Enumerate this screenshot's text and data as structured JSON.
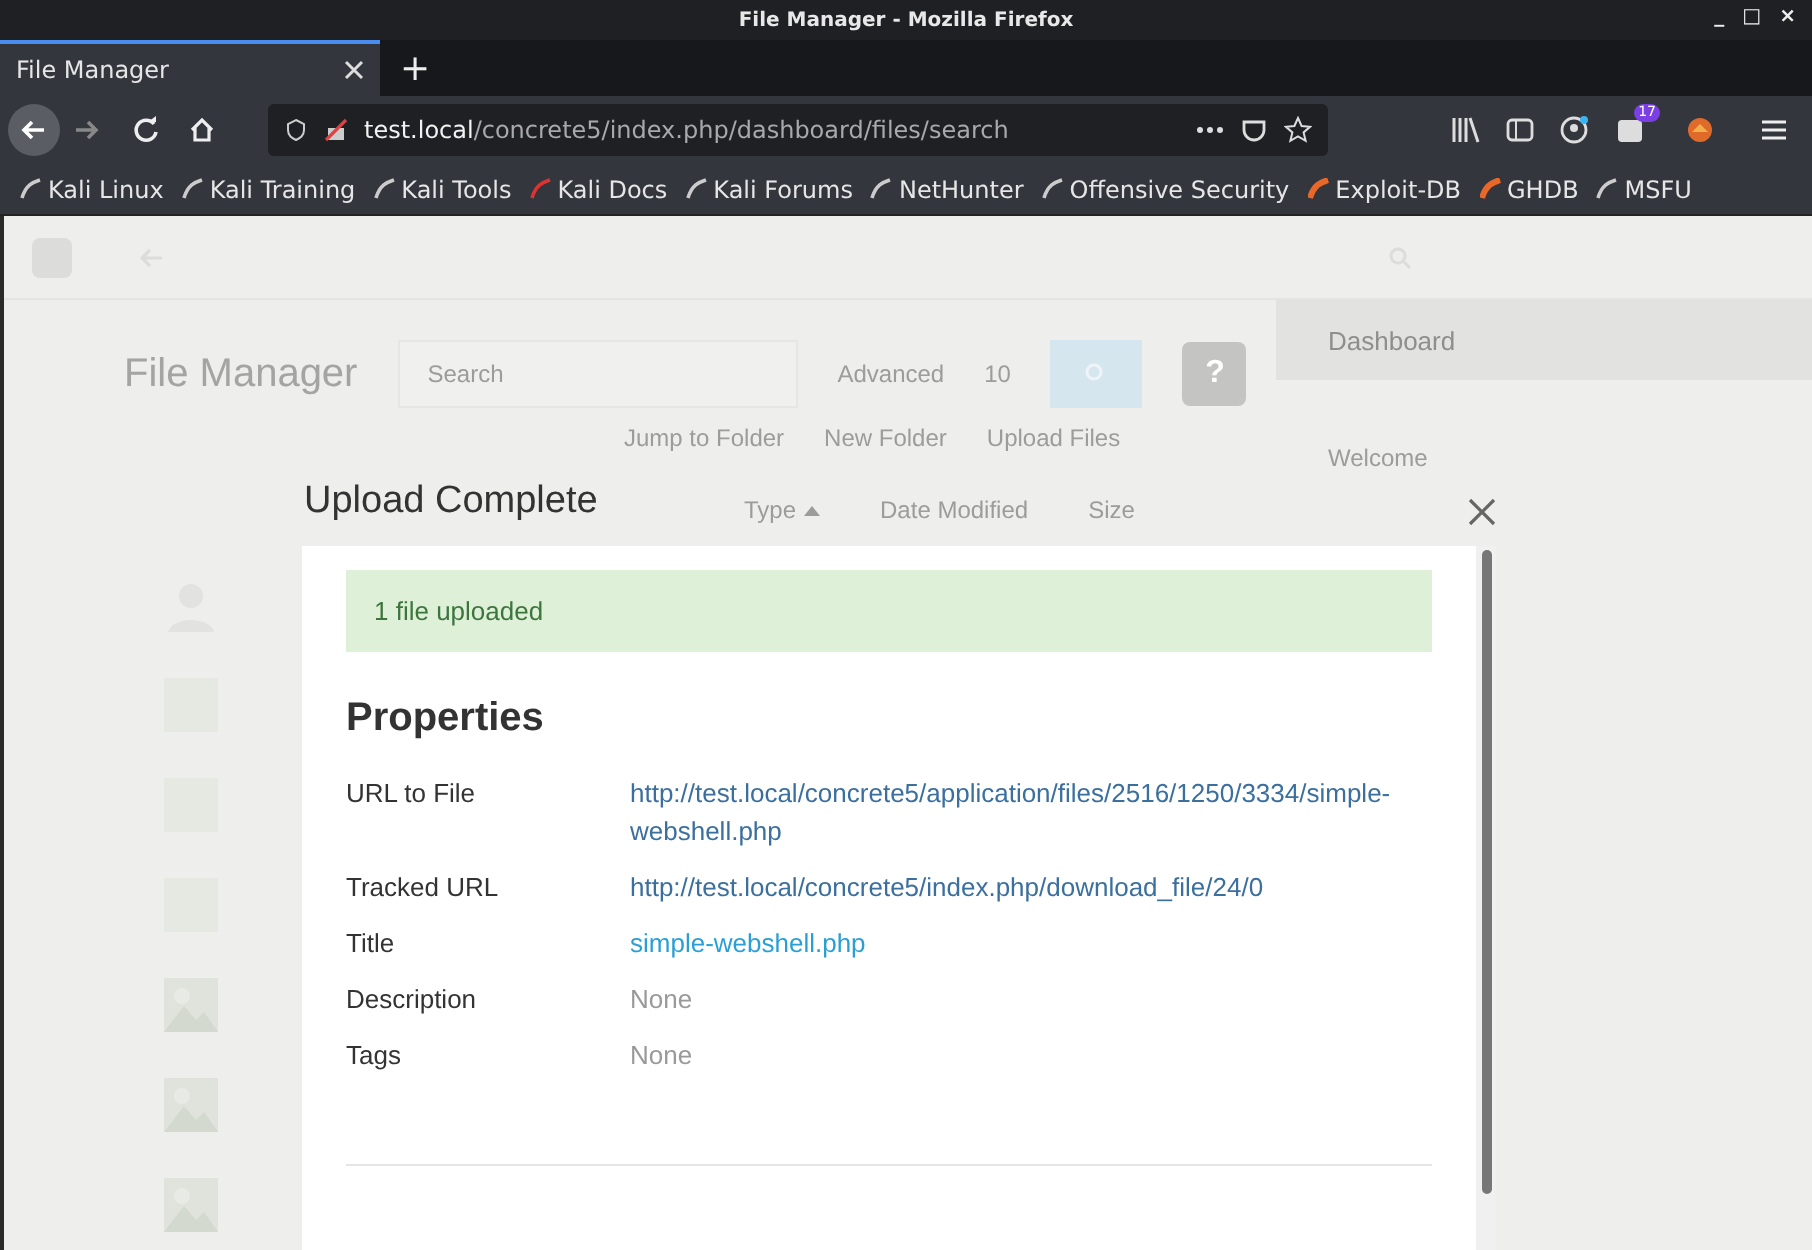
{
  "window": {
    "title": "File Manager - Mozilla Firefox",
    "controls": [
      "_",
      "□",
      "×"
    ]
  },
  "browser": {
    "tabs": [
      {
        "label": "File Manager",
        "selected": true
      }
    ],
    "new_tab": "+",
    "address": {
      "host": "test.local",
      "path": "/concrete5/index.php/dashboard/files/search"
    },
    "badge": "17",
    "bookmarks": [
      {
        "label": "Kali Linux"
      },
      {
        "label": "Kali Training"
      },
      {
        "label": "Kali Tools"
      },
      {
        "label": "Kali Docs"
      },
      {
        "label": "Kali Forums"
      },
      {
        "label": "NetHunter"
      },
      {
        "label": "Offensive Security"
      },
      {
        "label": "Exploit-DB"
      },
      {
        "label": "GHDB"
      },
      {
        "label": "MSFU"
      }
    ]
  },
  "page": {
    "heading": "File Manager",
    "search": {
      "placeholder": "Search"
    },
    "advanced": "Advanced",
    "help": "?",
    "per_page": "10",
    "actions": [
      "Jump to Folder",
      "New Folder",
      "Upload Files"
    ],
    "columns": [
      {
        "label": "Type",
        "sorted": true
      },
      {
        "label": "Date Modified",
        "sorted": false
      },
      {
        "label": "Size",
        "sorted": false
      }
    ],
    "rows": [
      {
        "kind": "avatar"
      },
      {
        "kind": "blank"
      },
      {
        "kind": "blank"
      },
      {
        "kind": "blank"
      },
      {
        "kind": "picture"
      },
      {
        "kind": "picture"
      },
      {
        "kind": "picture"
      }
    ],
    "sidebar": {
      "header": "Dashboard",
      "items": [
        "Welcome"
      ]
    }
  },
  "modal": {
    "title": "Upload Complete",
    "alert": "1 file uploaded",
    "heading": "Properties",
    "properties": [
      {
        "label": "URL to File",
        "value": "http://test.local/concrete5/application/files/2516/1250/3334/simple-webshell.php",
        "kind": "link"
      },
      {
        "label": "Tracked URL",
        "value": "http://test.local/concrete5/index.php/download_file/24/0",
        "kind": "link"
      },
      {
        "label": "Title",
        "value": "simple-webshell.php",
        "kind": "editable"
      },
      {
        "label": "Description",
        "value": "None",
        "kind": "empty"
      },
      {
        "label": "Tags",
        "value": "None",
        "kind": "empty"
      }
    ]
  }
}
